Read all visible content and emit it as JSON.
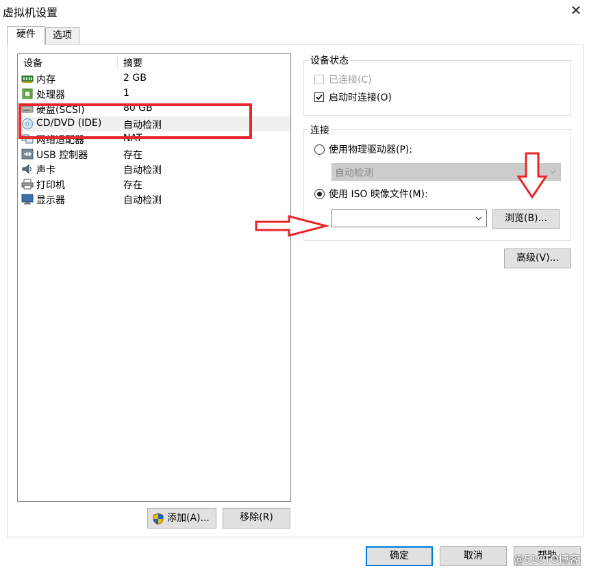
{
  "window": {
    "title": "虚拟机设置",
    "close_glyph": "✕"
  },
  "tabs": [
    {
      "label": "硬件",
      "active": true
    },
    {
      "label": "选项",
      "active": false
    }
  ],
  "device_list": {
    "columns": [
      "设备",
      "摘要"
    ],
    "rows": [
      {
        "name": "内存",
        "summary": "2 GB",
        "icon": "memory-icon"
      },
      {
        "name": "处理器",
        "summary": "1",
        "icon": "processor-icon"
      },
      {
        "name": "硬盘(SCSI)",
        "summary": "80 GB",
        "icon": "hard-disk-icon"
      },
      {
        "name": "CD/DVD (IDE)",
        "summary": "自动检测",
        "icon": "cd-dvd-icon",
        "selected": true
      },
      {
        "name": "网络适配器",
        "summary": "NAT",
        "icon": "network-adapter-icon"
      },
      {
        "name": "USB 控制器",
        "summary": "存在",
        "icon": "usb-icon"
      },
      {
        "name": "声卡",
        "summary": "自动检测",
        "icon": "sound-card-icon"
      },
      {
        "name": "打印机",
        "summary": "存在",
        "icon": "printer-icon"
      },
      {
        "name": "显示器",
        "summary": "自动检测",
        "icon": "display-icon"
      }
    ]
  },
  "list_buttons": {
    "add": "添加(A)...",
    "remove": "移除(R)"
  },
  "device_status": {
    "title": "设备状态",
    "connected": {
      "label": "已连接(C)",
      "checked": false,
      "enabled": false
    },
    "connect_at_power_on": {
      "label": "启动时连接(O)",
      "checked": true
    }
  },
  "connection": {
    "title": "连接",
    "physical_drive": {
      "label": "使用物理驱动器(P):",
      "selected": false,
      "dropdown_value": "自动检测"
    },
    "iso_image": {
      "label": "使用 ISO 映像文件(M):",
      "selected": true,
      "path_value": ""
    },
    "browse": "浏览(B)..."
  },
  "advanced": "高级(V)...",
  "footer": {
    "ok": "确定",
    "cancel": "取消",
    "help": "帮助"
  },
  "watermark": "@51CTO博客",
  "colors": {
    "annotation_red": "#e8262b",
    "accent_blue": "#0078d7"
  }
}
